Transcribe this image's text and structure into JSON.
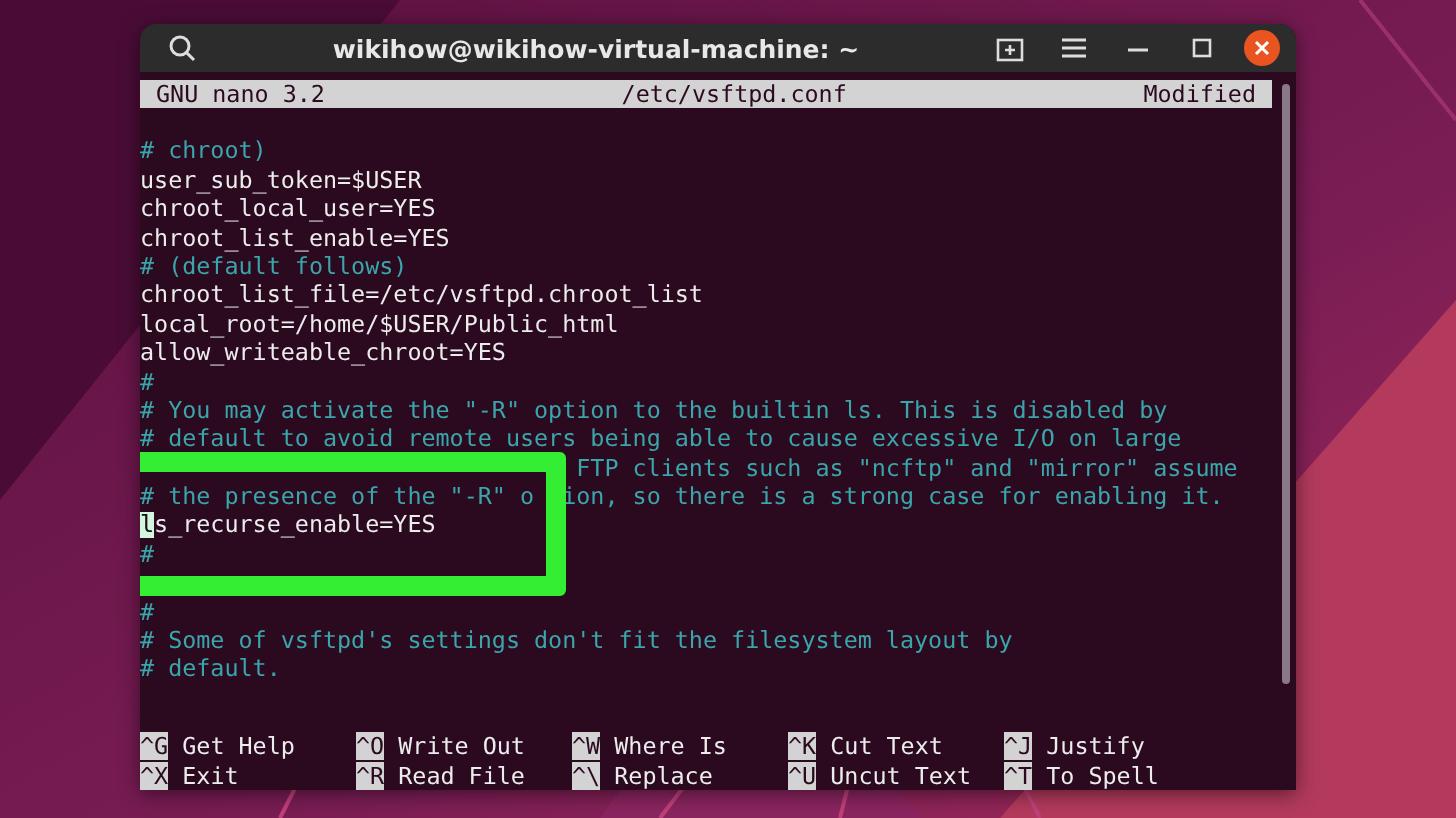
{
  "window": {
    "title": "wikihow@wikihow-virtual-machine: ~"
  },
  "editor": {
    "app": "GNU nano 3.2",
    "file": "/etc/vsftpd.conf",
    "status": "Modified",
    "lines": [
      {
        "kind": "comment",
        "text": "# chroot)",
        "cursor": false
      },
      {
        "kind": "setting",
        "text": "user_sub_token=$USER",
        "cursor": false
      },
      {
        "kind": "setting",
        "text": "chroot_local_user=YES",
        "cursor": false
      },
      {
        "kind": "setting",
        "text": "chroot_list_enable=YES",
        "cursor": false
      },
      {
        "kind": "comment",
        "text": "# (default follows)",
        "cursor": false
      },
      {
        "kind": "setting",
        "text": "chroot_list_file=/etc/vsftpd.chroot_list",
        "cursor": false
      },
      {
        "kind": "setting",
        "text": "local_root=/home/$USER/Public_html",
        "cursor": false
      },
      {
        "kind": "setting",
        "text": "allow_writeable_chroot=YES",
        "cursor": false
      },
      {
        "kind": "comment",
        "text": "#",
        "cursor": false
      },
      {
        "kind": "comment",
        "text": "# You may activate the \"-R\" option to the builtin ls. This is disabled by",
        "cursor": false
      },
      {
        "kind": "comment",
        "text": "# default to avoid remote users being able to cause excessive I/O on large",
        "cursor": false
      },
      {
        "kind": "covered",
        "text": "FTP clients such as \"ncftp\" and \"mirror\" assume",
        "cursor": false
      },
      {
        "kind": "split",
        "parts": [
          "# the presence of the \"-R\" o",
          "ion, so there is a strong case for enabling it."
        ],
        "cursor": false
      },
      {
        "kind": "setting",
        "text": "ls_recurse_enable=YES",
        "cursor": true
      },
      {
        "kind": "comment",
        "text": "#",
        "cursor": false
      },
      {
        "kind": "blank",
        "cursor": false
      },
      {
        "kind": "comment",
        "text": "#",
        "cursor": false
      },
      {
        "kind": "comment",
        "text": "# Some of vsftpd's settings don't fit the filesystem layout by",
        "cursor": false
      },
      {
        "kind": "comment",
        "text": "# default.",
        "cursor": false
      },
      {
        "kind": "blank",
        "cursor": false
      }
    ],
    "shortcuts": [
      {
        "key": "^G",
        "label": "Get Help"
      },
      {
        "key": "^X",
        "label": "Exit"
      },
      {
        "key": "^O",
        "label": "Write Out"
      },
      {
        "key": "^R",
        "label": "Read File"
      },
      {
        "key": "^W",
        "label": "Where Is"
      },
      {
        "key": "^\\",
        "label": "Replace"
      },
      {
        "key": "^K",
        "label": "Cut Text"
      },
      {
        "key": "^U",
        "label": "Uncut Text"
      },
      {
        "key": "^J",
        "label": "Justify"
      },
      {
        "key": "^T",
        "label": "To Spell"
      }
    ]
  }
}
